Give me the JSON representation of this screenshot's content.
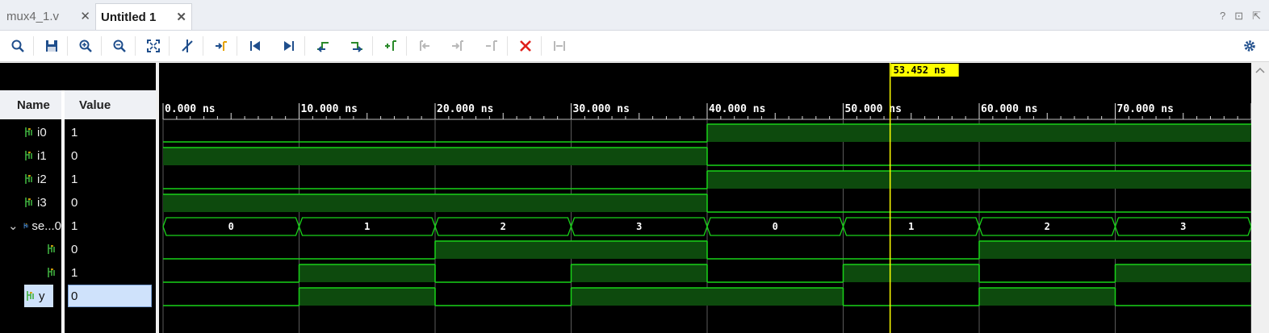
{
  "tabs": [
    {
      "label": "mux4_1.v",
      "active": false
    },
    {
      "label": "Untitled 1",
      "active": true
    }
  ],
  "window_controls": {
    "help": "?",
    "restore": "⊡",
    "float": "⇱"
  },
  "toolbar": {
    "icons": [
      "search-icon",
      "save-icon",
      "zoom-in-icon",
      "zoom-out-icon",
      "zoom-fit-icon",
      "cursor-snap-icon",
      "go-to-cursor-icon",
      "go-to-start-icon",
      "go-to-end-icon",
      "previous-transition-icon",
      "next-transition-icon",
      "add-marker-icon",
      "previous-marker-icon",
      "next-marker-icon",
      "remove-marker-icon",
      "delete-icon",
      "swap-cursors-icon"
    ],
    "settings_icon": "gear-icon"
  },
  "headers": {
    "name": "Name",
    "value": "Value"
  },
  "signals": [
    {
      "name": "i0",
      "value": "1",
      "indent": 0,
      "expand": ""
    },
    {
      "name": "i1",
      "value": "0",
      "indent": 0,
      "expand": ""
    },
    {
      "name": "i2",
      "value": "1",
      "indent": 0,
      "expand": ""
    },
    {
      "name": "i3",
      "value": "0",
      "indent": 0,
      "expand": ""
    },
    {
      "name": "se...0",
      "value": "1",
      "indent": 0,
      "expand": "⌄"
    },
    {
      "name": "",
      "value": "0",
      "indent": 1,
      "expand": ""
    },
    {
      "name": "",
      "value": "1",
      "indent": 1,
      "expand": ""
    },
    {
      "name": "y",
      "value": "0",
      "indent": 0,
      "expand": "",
      "selected": true
    }
  ],
  "timeline": {
    "cursor_label": "53.452 ns",
    "cursor_ns": 53.452,
    "visible_range_ns": [
      0,
      80
    ],
    "tick_labels": [
      "0.000 ns",
      "10.000 ns",
      "20.000 ns",
      "30.000 ns",
      "40.000 ns",
      "50.000 ns",
      "60.000 ns",
      "70.000 ns"
    ]
  },
  "waves": {
    "i0": [
      [
        0,
        0
      ],
      [
        40,
        1
      ]
    ],
    "i1": [
      [
        0,
        1
      ],
      [
        40,
        0
      ]
    ],
    "i2": [
      [
        0,
        0
      ],
      [
        40,
        1
      ]
    ],
    "i3": [
      [
        0,
        1
      ],
      [
        40,
        0
      ]
    ],
    "sel_bus": [
      {
        "t0": 0,
        "t1": 10,
        "v": "0"
      },
      {
        "t0": 10,
        "t1": 20,
        "v": "1"
      },
      {
        "t0": 20,
        "t1": 30,
        "v": "2"
      },
      {
        "t0": 30,
        "t1": 40,
        "v": "3"
      },
      {
        "t0": 40,
        "t1": 50,
        "v": "0"
      },
      {
        "t0": 50,
        "t1": 60,
        "v": "1"
      },
      {
        "t0": 60,
        "t1": 70,
        "v": "2"
      },
      {
        "t0": 70,
        "t1": 80,
        "v": "3"
      }
    ],
    "sel1": [
      [
        0,
        0
      ],
      [
        20,
        1
      ],
      [
        40,
        0
      ],
      [
        60,
        1
      ]
    ],
    "sel0": [
      [
        0,
        0
      ],
      [
        10,
        1
      ],
      [
        20,
        0
      ],
      [
        30,
        1
      ],
      [
        40,
        0
      ],
      [
        50,
        1
      ],
      [
        60,
        0
      ],
      [
        70,
        1
      ]
    ],
    "y": [
      [
        0,
        0
      ],
      [
        10,
        1
      ],
      [
        20,
        0
      ],
      [
        30,
        1
      ],
      [
        50,
        0
      ],
      [
        60,
        1
      ],
      [
        70,
        0
      ]
    ]
  },
  "colors": {
    "wave": "#19d219",
    "wave_fill": "#0d4a0d",
    "cursor": "#ffff00",
    "grid": "#5a5a5a",
    "bg": "#000000"
  }
}
